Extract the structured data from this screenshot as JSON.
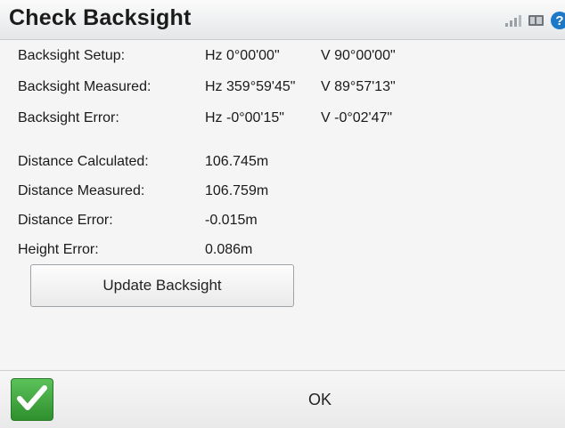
{
  "window": {
    "title": "Check Backsight"
  },
  "toolbar_icons": [
    "signal-bars-icon",
    "battery-icon",
    "help-icon"
  ],
  "help_glyph": "?",
  "backsight": [
    {
      "label": "Backsight Setup:",
      "hz": "Hz 0°00'00\"",
      "v": "V 90°00'00\""
    },
    {
      "label": "Backsight Measured:",
      "hz": "Hz 359°59'45\"",
      "v": "V 89°57'13\""
    },
    {
      "label": "Backsight Error:",
      "hz": "Hz -0°00'15\"",
      "v": "V -0°02'47\""
    }
  ],
  "distances": [
    {
      "label": "Distance Calculated:",
      "value": "106.745m"
    },
    {
      "label": "Distance Measured:",
      "value": "106.759m"
    },
    {
      "label": "Distance Error:",
      "value": "-0.015m"
    },
    {
      "label": "Height Error:",
      "value": "0.086m"
    }
  ],
  "buttons": {
    "update_backsight": "Update Backsight",
    "ok": "OK"
  },
  "colors": {
    "accent_green": "#3aa63a",
    "help_blue": "#1e78c8"
  }
}
